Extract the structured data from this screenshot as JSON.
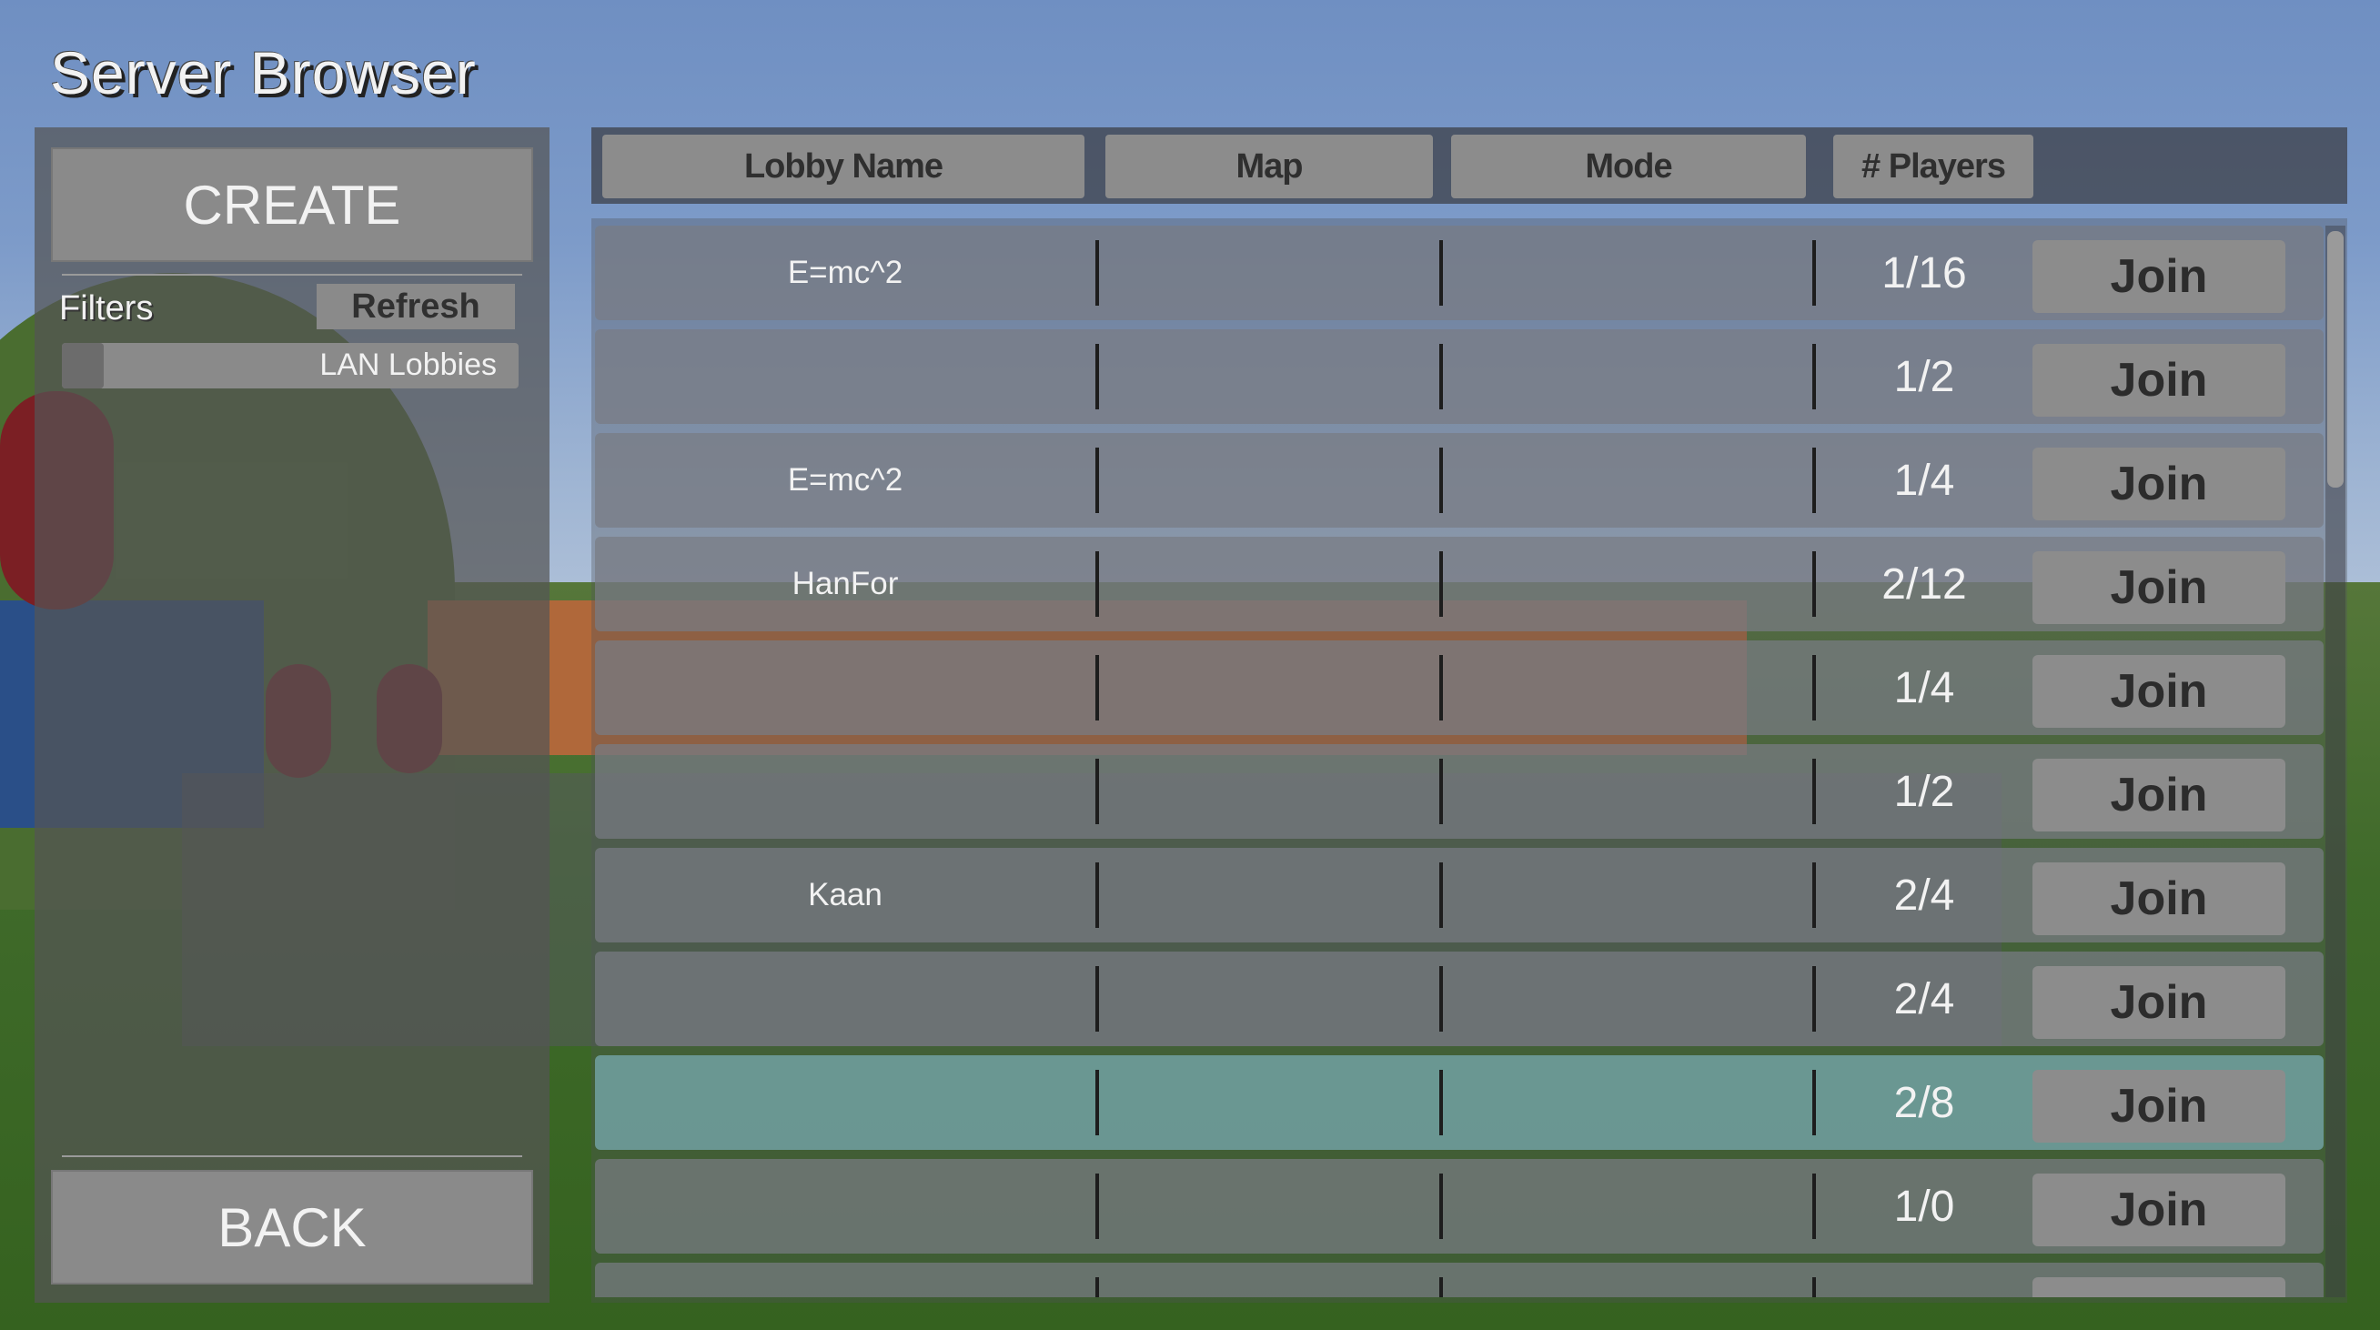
{
  "window": {
    "title": "Server Browser"
  },
  "left_panel": {
    "create_label": "CREATE",
    "filters_label": "Filters",
    "refresh_label": "Refresh",
    "lan_toggle_label": "LAN Lobbies",
    "back_label": "BACK"
  },
  "header": {
    "columns": [
      "Lobby Name",
      "Map",
      "Mode",
      "# Players"
    ]
  },
  "lobbies": [
    {
      "name": "E=mc^2",
      "map": "",
      "mode": "",
      "players": "1/16",
      "join_label": "Join"
    },
    {
      "name": "",
      "map": "",
      "mode": "",
      "players": "1/2",
      "join_label": "Join"
    },
    {
      "name": "E=mc^2",
      "map": "",
      "mode": "",
      "players": "1/4",
      "join_label": "Join"
    },
    {
      "name": "HanFor",
      "map": "",
      "mode": "",
      "players": "2/12",
      "join_label": "Join"
    },
    {
      "name": "",
      "map": "",
      "mode": "",
      "players": "1/4",
      "join_label": "Join"
    },
    {
      "name": "",
      "map": "",
      "mode": "",
      "players": "1/2",
      "join_label": "Join"
    },
    {
      "name": "Kaan",
      "map": "",
      "mode": "",
      "players": "2/4",
      "join_label": "Join"
    },
    {
      "name": "",
      "map": "",
      "mode": "",
      "players": "2/4",
      "join_label": "Join"
    },
    {
      "name": "",
      "map": "",
      "mode": "",
      "players": "2/8",
      "join_label": "Join",
      "selected": true
    },
    {
      "name": "",
      "map": "",
      "mode": "",
      "players": "1/0",
      "join_label": "Join"
    },
    {
      "name": "",
      "map": "",
      "mode": "",
      "players": "",
      "join_label": ""
    }
  ],
  "colors": {
    "panel": "#555555",
    "button": "#8c8c8c",
    "row": "#787c84",
    "row_selected": "#76a6ac",
    "title_text": "#f2f2f2"
  }
}
